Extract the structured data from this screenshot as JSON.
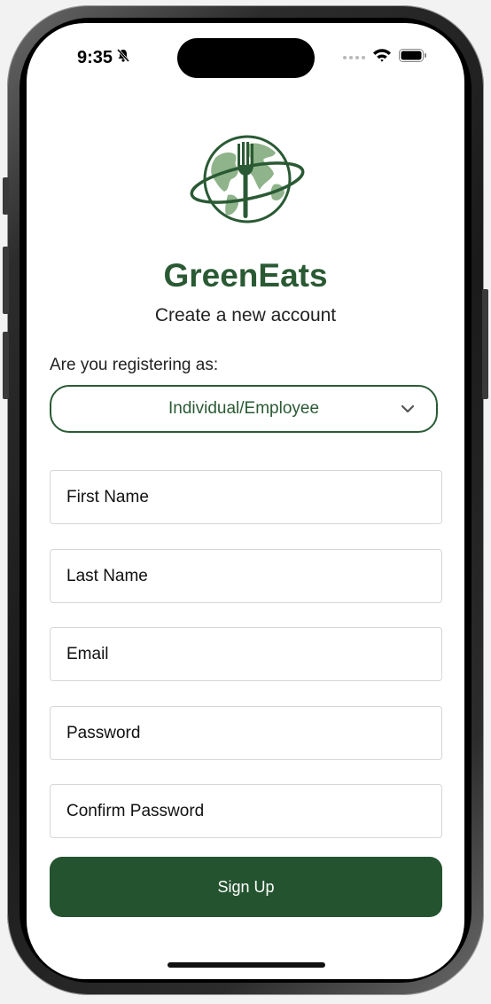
{
  "status_bar": {
    "time": "9:35"
  },
  "app": {
    "brand": "GreenEats",
    "subtitle": "Create a new account"
  },
  "registration": {
    "label": "Are you registering as:",
    "selected_role": "Individual/Employee"
  },
  "form": {
    "first_name_placeholder": "First Name",
    "last_name_placeholder": "Last Name",
    "email_placeholder": "Email",
    "password_placeholder": "Password",
    "confirm_password_placeholder": "Confirm Password",
    "signup_label": "Sign Up"
  },
  "colors": {
    "brand_green": "#2a5a34",
    "button_green": "#24532f",
    "logo_light_green": "#8fb38a"
  },
  "icons": [
    "mute-bell-icon",
    "cellular-dots-icon",
    "wifi-icon",
    "battery-icon",
    "globe-fork-logo",
    "chevron-down-icon"
  ]
}
